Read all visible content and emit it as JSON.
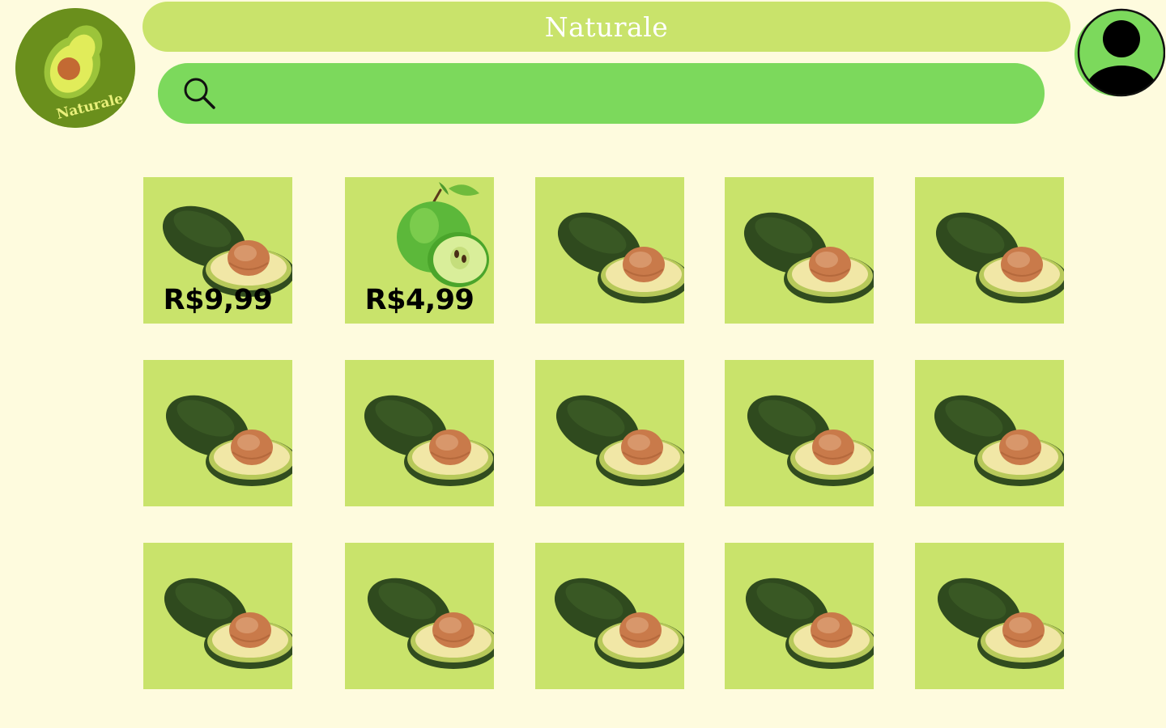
{
  "app": {
    "title": "Naturale",
    "logo_text": "Naturale"
  },
  "search": {
    "value": "",
    "placeholder": ""
  },
  "colors": {
    "background": "#fefbde",
    "title_bar": "#c9e36b",
    "search_bar": "#7cd95c",
    "card": "#c9e36b",
    "logo": "#6a8f1c",
    "avatar": "#7cd95c"
  },
  "products": [
    {
      "fruit": "avocado",
      "price": "R$9,99"
    },
    {
      "fruit": "green-apple",
      "price": "R$4,99"
    },
    {
      "fruit": "avocado",
      "price": ""
    },
    {
      "fruit": "avocado",
      "price": ""
    },
    {
      "fruit": "avocado",
      "price": ""
    },
    {
      "fruit": "avocado",
      "price": ""
    },
    {
      "fruit": "avocado",
      "price": ""
    },
    {
      "fruit": "avocado",
      "price": ""
    },
    {
      "fruit": "avocado",
      "price": ""
    },
    {
      "fruit": "avocado",
      "price": ""
    },
    {
      "fruit": "avocado",
      "price": ""
    },
    {
      "fruit": "avocado",
      "price": ""
    },
    {
      "fruit": "avocado",
      "price": ""
    },
    {
      "fruit": "avocado",
      "price": ""
    },
    {
      "fruit": "avocado",
      "price": ""
    }
  ]
}
